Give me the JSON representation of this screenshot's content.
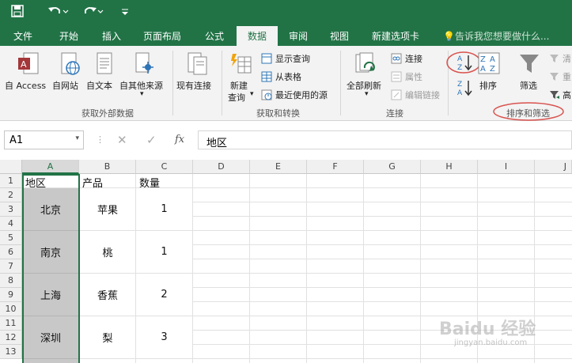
{
  "quick_access": {
    "save_icon": "save-icon",
    "undo_icon": "undo-icon",
    "redo_icon": "redo-icon",
    "customize_icon": "customize-qat-icon"
  },
  "tabs": [
    "文件",
    "开始",
    "插入",
    "页面布局",
    "公式",
    "数据",
    "审阅",
    "视图",
    "新建选项卡"
  ],
  "active_tab": "数据",
  "tell_me": "告诉我您想要做什么...",
  "ribbon": {
    "get_external": {
      "from_access": "自 Access",
      "from_web": "自网站",
      "from_text": "自文本",
      "from_other": "自其他来源",
      "existing": "现有连接",
      "label": "获取外部数据"
    },
    "get_transform": {
      "new_query_1": "新建",
      "new_query_2": "查询",
      "show_queries": "显示查询",
      "from_table": "从表格",
      "recent_sources": "最近使用的源",
      "label": "获取和转换"
    },
    "connections": {
      "refresh_all": "全部刷新",
      "connections": "连接",
      "properties": "属性",
      "edit_links": "编辑链接",
      "label": "连接"
    },
    "sort_filter": {
      "sort": "排序",
      "filter": "筛选",
      "clear": "清",
      "reapply": "重",
      "advanced": "高",
      "label": "排序和筛选"
    }
  },
  "formula_bar": {
    "name_box": "A1",
    "fx": "fx",
    "content": "地区"
  },
  "columns": [
    "A",
    "B",
    "C",
    "D",
    "E",
    "F",
    "G",
    "H",
    "I",
    "J"
  ],
  "rows": [
    "1",
    "2",
    "3",
    "4",
    "5",
    "6",
    "7",
    "8",
    "9",
    "10",
    "11",
    "12",
    "13"
  ],
  "headers": {
    "a1": "地区",
    "b1": "产品",
    "c1": "数量"
  },
  "data": [
    {
      "region": "北京",
      "product": "苹果",
      "qty": "1"
    },
    {
      "region": "南京",
      "product": "桃",
      "qty": "1"
    },
    {
      "region": "上海",
      "product": "香蕉",
      "qty": "2"
    },
    {
      "region": "深圳",
      "product": "梨",
      "qty": "3"
    }
  ],
  "watermark": {
    "brand": "Baidu 经验",
    "url": "jingyan.baidu.com"
  },
  "colors": {
    "excel_green": "#217346",
    "annotation_red": "#d9534f",
    "selection_gray": "#c8c8c8"
  }
}
